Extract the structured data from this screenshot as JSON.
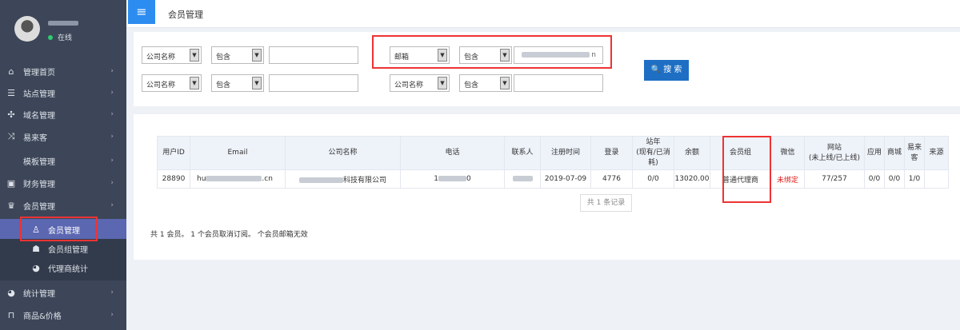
{
  "user": {
    "status": "在线"
  },
  "sidebar": {
    "items": [
      {
        "label": "管理首页",
        "icon": "home-icon",
        "glyph": "⌂"
      },
      {
        "label": "站点管理",
        "icon": "database-icon",
        "glyph": "☰"
      },
      {
        "label": "域名管理",
        "icon": "move-icon",
        "glyph": "✣"
      },
      {
        "label": "易来客",
        "icon": "shuffle-icon",
        "glyph": "⤨"
      },
      {
        "label": "模板管理",
        "icon": "",
        "glyph": ""
      },
      {
        "label": "财务管理",
        "icon": "wallet-icon",
        "glyph": "▣"
      },
      {
        "label": "会员管理",
        "icon": "crown-icon",
        "glyph": "♛"
      }
    ],
    "sub": [
      {
        "label": "会员管理",
        "glyph": "♙"
      },
      {
        "label": "会员组管理",
        "glyph": "☗"
      },
      {
        "label": "代理商统计",
        "glyph": "◕"
      }
    ],
    "bottom": [
      {
        "label": "统计管理",
        "glyph": "◕"
      },
      {
        "label": "商品&价格",
        "glyph": "⊓"
      }
    ],
    "chevron": "›"
  },
  "header": {
    "menu": "≡",
    "title": "会员管理"
  },
  "filters": {
    "row1": [
      {
        "field": "公司名称",
        "op": "包含",
        "value": ""
      },
      {
        "field": "邮箱",
        "op": "包含",
        "value": "n"
      }
    ],
    "row2": [
      {
        "field": "公司名称",
        "op": "包含",
        "value": ""
      },
      {
        "field": "公司名称",
        "op": "包含",
        "value": ""
      }
    ],
    "search": "🔍 搜 索",
    "arrow": "▼"
  },
  "table": {
    "headers": [
      "用户ID",
      "Email",
      "公司名称",
      "电话",
      "联系人",
      "注册时间",
      "登录",
      "站年\n(现有/已消耗)",
      "余额",
      "会员组",
      "微信",
      "网站\n(未上线/已上线)",
      "应用",
      "商城",
      "易来客",
      "来源"
    ],
    "row": {
      "id": "28890",
      "email_start": "hu",
      "email_end": ".cn",
      "company_end": "科技有限公司",
      "phone_start": "1",
      "phone_end": "0",
      "reg": "2019-07-09",
      "login": "4776",
      "zhan": "0/0",
      "balance": "13020.00",
      "group": "普通代理商",
      "wechat": "未绑定",
      "site": "77/257",
      "app": "0/0",
      "mall": "0/0",
      "ylk": "1/0",
      "source": ""
    }
  },
  "pager": "共 1 条记录",
  "summary": "共 1 会员。 1 个会员取消订阅。 个会员邮箱无效"
}
